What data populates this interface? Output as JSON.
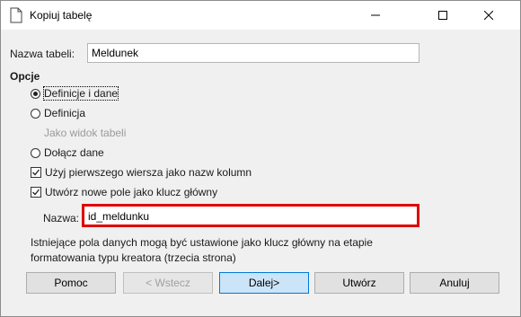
{
  "window": {
    "title": "Kopiuj tabelę"
  },
  "form": {
    "table_name_label": "Nazwa tabeli:",
    "table_name_value": "Meldunek",
    "options_heading": "Opcje",
    "options": [
      {
        "label": "Definicje i dane",
        "type": "radio",
        "checked": true,
        "enabled": true
      },
      {
        "label": "Definicja",
        "type": "radio",
        "checked": false,
        "enabled": true
      },
      {
        "label": "Jako widok tabeli",
        "type": "radio",
        "checked": false,
        "enabled": false
      },
      {
        "label": "Dołącz dane",
        "type": "radio",
        "checked": false,
        "enabled": true
      }
    ],
    "checkboxes": [
      {
        "label": "Użyj pierwszego wiersza jako nazw kolumn",
        "checked": true
      },
      {
        "label": "Utwórz nowe pole jako klucz główny",
        "checked": true
      }
    ],
    "key_name_label": "Nazwa:",
    "key_name_value": "id_meldunku",
    "info_line1": "Istniejące pola danych mogą być ustawione jako klucz główny na etapie",
    "info_line2": "formatowania typu kreatora (trzecia strona)"
  },
  "buttons": {
    "help": "Pomoc",
    "back": "< Wstecz",
    "next": "Dalej>",
    "create": "Utwórz",
    "cancel": "Anuluj"
  },
  "colors": {
    "highlight": "#e00000",
    "default_button": "#cce4f7",
    "default_button_border": "#0078d7"
  }
}
